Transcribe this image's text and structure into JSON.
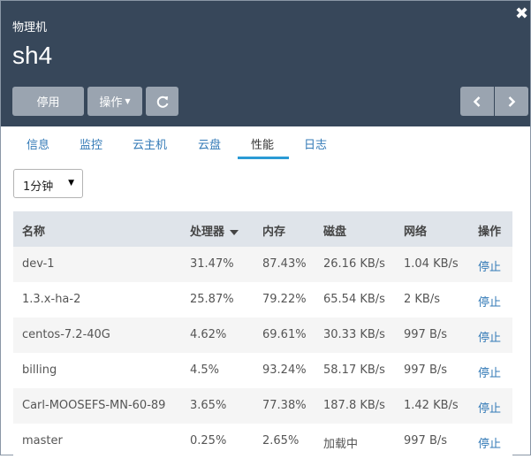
{
  "header": {
    "subtitle": "物理机",
    "title": "sh4"
  },
  "toolbar": {
    "disable_label": "停用",
    "ops_label": "操作"
  },
  "tabs": [
    {
      "label": "信息"
    },
    {
      "label": "监控"
    },
    {
      "label": "云主机"
    },
    {
      "label": "云盘"
    },
    {
      "label": "性能",
      "active": true
    },
    {
      "label": "日志"
    }
  ],
  "interval_select": {
    "value": "1分钟"
  },
  "table": {
    "columns": [
      "名称",
      "处理器",
      "内存",
      "磁盘",
      "网络",
      "操作"
    ],
    "sorted_column": "处理器",
    "rows": [
      {
        "name": "dev-1",
        "cpu": "31.47%",
        "mem": "87.43%",
        "disk": "26.16 KB/s",
        "net": "1.04 KB/s",
        "action": "停止"
      },
      {
        "name": "1.3.x-ha-2",
        "cpu": "25.87%",
        "mem": "79.22%",
        "disk": "65.54 KB/s",
        "net": "2 KB/s",
        "action": "停止"
      },
      {
        "name": "centos-7.2-40G",
        "cpu": "4.62%",
        "mem": "69.61%",
        "disk": "30.33 KB/s",
        "net": "997 B/s",
        "action": "停止"
      },
      {
        "name": "billing",
        "cpu": "4.5%",
        "mem": "93.24%",
        "disk": "58.17 KB/s",
        "net": "997 B/s",
        "action": "停止"
      },
      {
        "name": "Carl-MOOSEFS-MN-60-89",
        "cpu": "3.65%",
        "mem": "77.38%",
        "disk": "187.8 KB/s",
        "net": "1.42 KB/s",
        "action": "停止"
      },
      {
        "name": "master",
        "cpu": "0.25%",
        "mem": "2.65%",
        "disk": "加载中",
        "net": "997 B/s",
        "action": "停止"
      }
    ]
  },
  "icons": {
    "close": "close-icon",
    "refresh": "refresh-icon",
    "prev": "chevron-left-icon",
    "next": "chevron-right-icon",
    "dropdown": "caret-down-icon",
    "sort": "sort-desc-icon"
  },
  "colors": {
    "header_bg": "#37475a",
    "button_bg": "#9aa4b0",
    "link": "#337ab7",
    "tab_active_underline": "#2a9ad5",
    "table_header_bg": "#dfe4ea"
  }
}
